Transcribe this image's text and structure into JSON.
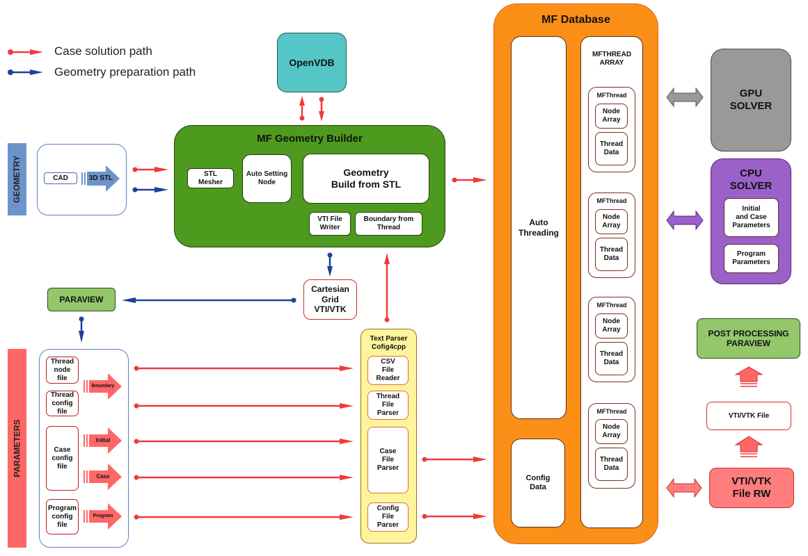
{
  "legend": {
    "items": [
      {
        "label": "Case solution path",
        "color": "#f03a3a"
      },
      {
        "label": "Geometry preparation  path",
        "color": "#1f3f9a"
      }
    ]
  },
  "colors": {
    "case_path": "#f03a3a",
    "geometry_path": "#1f3f9a",
    "builder_green": "#4e9a1e",
    "database_orange": "#fb8f17",
    "openvdb_teal": "#54c6c6",
    "gpu_gray": "#999999",
    "cpu_purple": "#9a62c9",
    "paraview_green": "#94c66b",
    "geometry_side": "#6d93cb",
    "parameters_side": "#ff6766",
    "parser_yellow": "#fdf59b",
    "file_rw_red": "#ff7d7d"
  },
  "sections": {
    "geometry": "GEOMETRY",
    "parameters": "PARAMETERS"
  },
  "geometry_input": {
    "cad": "CAD",
    "stl_arrow": "3D STL"
  },
  "openvdb": "OpenVDB",
  "builder": {
    "title": "MF Geometry Builder",
    "stl_mesher": "STL\nMesher",
    "auto_setting": "Auto Setting\nNode",
    "geometry_build": "Geometry\nBuild from STL",
    "vti_writer": "VTI File\nWriter",
    "boundary": "Boundary from\nThread"
  },
  "cartesian_grid": "Cartesian\nGrid\nVTI/VTK",
  "paraview": "PARAVIEW",
  "parameters_files": {
    "thread_node": "Thread\nnode\nfile",
    "thread_config": "Thread\nconfig\nfile",
    "case_config": "Case\nconfig\nfile",
    "program_config": "Program\nconfig\nfile",
    "arrows": [
      "Boundary",
      "Initial",
      "Case",
      "Program"
    ]
  },
  "text_parser": {
    "title": "Text Parser\nCofig4cpp",
    "items": [
      "CSV\nFile\nReader",
      "Thread\nFile\nParser",
      "Case\nFile\nParser",
      "Config\nFile\nParser"
    ]
  },
  "database": {
    "title": "MF Database",
    "auto_threading": "Auto\nThreading",
    "config_data": "Config\nData",
    "array_title": "MFTHREAD\nARRAY",
    "threads": [
      {
        "title": "MFThread",
        "node": "Node\nArray",
        "data": "Thread\nData"
      },
      {
        "title": "MFThread",
        "node": "Node\nArray",
        "data": "Thread\nData"
      },
      {
        "title": "MFThread",
        "node": "Node\nArray",
        "data": "Thread\nData"
      },
      {
        "title": "MFThread",
        "node": "Node\nArray",
        "data": "Thread\nData"
      }
    ]
  },
  "gpu_solver": "GPU\nSOLVER",
  "cpu_solver": {
    "title": "CPU\nSOLVER",
    "initial": "Initial\nand Case\nParameters",
    "program": "Program\nParameters"
  },
  "post_processing": "POST PROCESSING\nPARAVIEW",
  "vti_file": "VTI/VTK File",
  "vti_rw": "VTI/VTK\nFile RW"
}
